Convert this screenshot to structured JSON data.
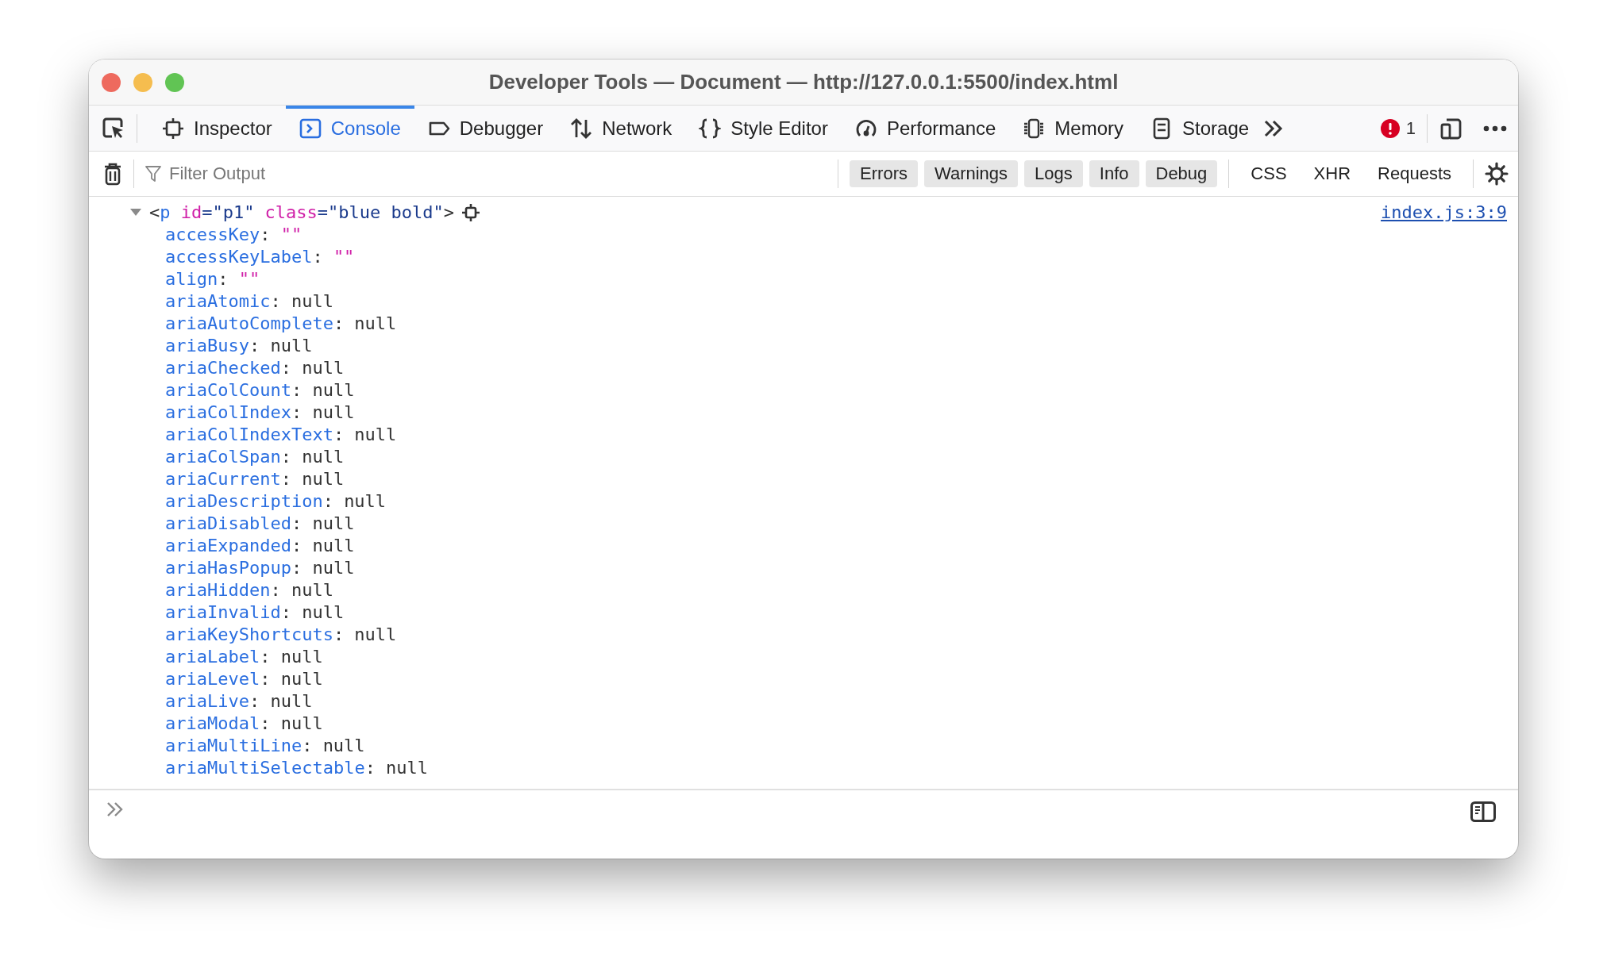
{
  "window": {
    "title": "Developer Tools — Document — http://127.0.0.1:5500/index.html"
  },
  "tabs": [
    {
      "label": "Inspector",
      "selected": false
    },
    {
      "label": "Console",
      "selected": true
    },
    {
      "label": "Debugger",
      "selected": false
    },
    {
      "label": "Network",
      "selected": false
    },
    {
      "label": "Style Editor",
      "selected": false
    },
    {
      "label": "Performance",
      "selected": false
    },
    {
      "label": "Memory",
      "selected": false
    },
    {
      "label": "Storage",
      "selected": false
    }
  ],
  "error_count": "1",
  "filter": {
    "placeholder": "Filter Output"
  },
  "level_filters": [
    {
      "label": "Errors",
      "selected": true
    },
    {
      "label": "Warnings",
      "selected": true
    },
    {
      "label": "Logs",
      "selected": true
    },
    {
      "label": "Info",
      "selected": true
    },
    {
      "label": "Debug",
      "selected": true
    }
  ],
  "type_filters": [
    {
      "label": "CSS",
      "selected": false
    },
    {
      "label": "XHR",
      "selected": false
    },
    {
      "label": "Requests",
      "selected": false
    }
  ],
  "message": {
    "expanded": true,
    "location": "index.js:3:9",
    "preview": [
      {
        "kind": "punct",
        "text": "<"
      },
      {
        "kind": "tag",
        "text": "p"
      },
      {
        "kind": "attr",
        "text": "id"
      },
      {
        "kind": "value",
        "text": "=\"p1\""
      },
      {
        "kind": "attr",
        "text": "class"
      },
      {
        "kind": "value",
        "text": "=\"blue bold\""
      },
      {
        "kind": "punct",
        "text": ">"
      }
    ],
    "properties": [
      {
        "name": "accessKey",
        "sep": ":",
        "value": "\"\"",
        "kind": "string"
      },
      {
        "name": "accessKeyLabel",
        "sep": ":",
        "value": "\"\"",
        "kind": "string"
      },
      {
        "name": "align",
        "sep": ":",
        "value": "\"\"",
        "kind": "string"
      },
      {
        "name": "ariaAtomic",
        "sep": ":",
        "value": "null",
        "kind": "null"
      },
      {
        "name": "ariaAutoComplete",
        "sep": ":",
        "value": "null",
        "kind": "null"
      },
      {
        "name": "ariaBusy",
        "sep": ":",
        "value": "null",
        "kind": "null"
      },
      {
        "name": "ariaChecked",
        "sep": ":",
        "value": "null",
        "kind": "null"
      },
      {
        "name": "ariaColCount",
        "sep": ":",
        "value": "null",
        "kind": "null"
      },
      {
        "name": "ariaColIndex",
        "sep": ":",
        "value": "null",
        "kind": "null"
      },
      {
        "name": "ariaColIndexText",
        "sep": ":",
        "value": "null",
        "kind": "null"
      },
      {
        "name": "ariaColSpan",
        "sep": ":",
        "value": "null",
        "kind": "null"
      },
      {
        "name": "ariaCurrent",
        "sep": ":",
        "value": "null",
        "kind": "null"
      },
      {
        "name": "ariaDescription",
        "sep": ":",
        "value": "null",
        "kind": "null"
      },
      {
        "name": "ariaDisabled",
        "sep": ":",
        "value": "null",
        "kind": "null"
      },
      {
        "name": "ariaExpanded",
        "sep": ":",
        "value": "null",
        "kind": "null"
      },
      {
        "name": "ariaHasPopup",
        "sep": ":",
        "value": "null",
        "kind": "null"
      },
      {
        "name": "ariaHidden",
        "sep": ":",
        "value": "null",
        "kind": "null"
      },
      {
        "name": "ariaInvalid",
        "sep": ":",
        "value": "null",
        "kind": "null"
      },
      {
        "name": "ariaKeyShortcuts",
        "sep": ":",
        "value": "null",
        "kind": "null"
      },
      {
        "name": "ariaLabel",
        "sep": ":",
        "value": "null",
        "kind": "null"
      },
      {
        "name": "ariaLevel",
        "sep": ":",
        "value": "null",
        "kind": "null"
      },
      {
        "name": "ariaLive",
        "sep": ":",
        "value": "null",
        "kind": "null"
      },
      {
        "name": "ariaModal",
        "sep": ":",
        "value": "null",
        "kind": "null"
      },
      {
        "name": "ariaMultiLine",
        "sep": ":",
        "value": "null",
        "kind": "null"
      },
      {
        "name": "ariaMultiSelectable",
        "sep": ":",
        "value": "null",
        "kind": "null"
      }
    ]
  }
}
